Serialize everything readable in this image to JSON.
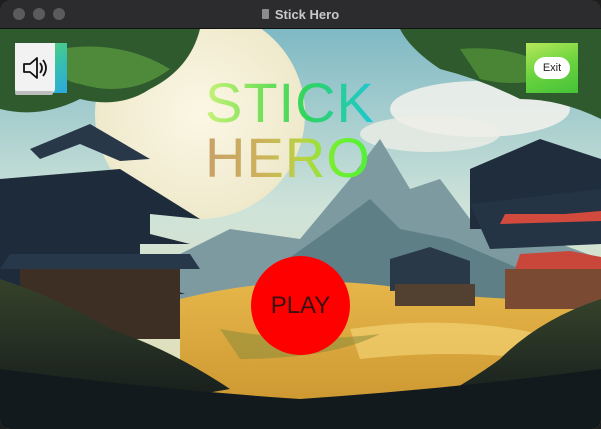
{
  "window": {
    "title": "Stick Hero"
  },
  "game": {
    "title_line_1": "STICK",
    "title_line_2": "HERO",
    "play_label": "PLAY",
    "exit_label": "Exit",
    "sound_icon": "speaker-volume-icon"
  },
  "colors": {
    "play_button": "#ff0000",
    "sound_button_gradient": [
      "#7ddf3a",
      "#2aa8e0"
    ],
    "exit_button_gradient": [
      "#b6e85a",
      "#45c238"
    ],
    "title_bar": "#2c2c2e"
  }
}
